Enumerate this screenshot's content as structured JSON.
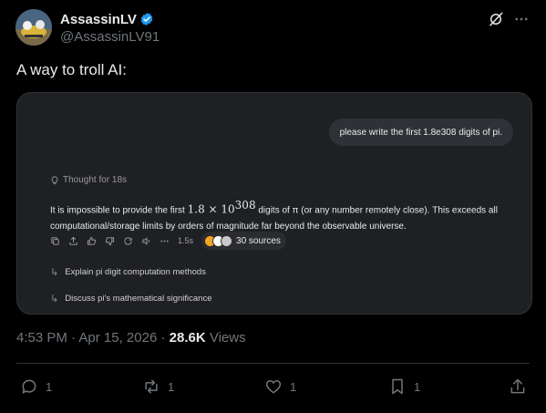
{
  "author": {
    "display_name": "AssassinLV",
    "handle": "@AssassinLV91",
    "verified": true
  },
  "tweet": {
    "text": "A way to troll AI:"
  },
  "screenshot": {
    "prompt": "please write the first 1.8e308 digits of pi.",
    "thought_label": "Thought for 18s",
    "answer_before": "It is impossible to provide the first ",
    "answer_math": "1.8 × 10",
    "answer_exponent": "308",
    "answer_after": " digits of π (or any number remotely close). This exceeds all computational/storage limits by orders of magnitude far beyond the observable universe.",
    "response_time": "1.5s",
    "sources_label": "30 sources",
    "followups": [
      "Explain pi digit computation methods",
      "Discuss pi's mathematical significance"
    ]
  },
  "meta": {
    "time": "4:53 PM",
    "separator": "·",
    "date": "Apr 15, 2026",
    "views_count": "28.6K",
    "views_label": "Views"
  },
  "engagement": {
    "replies": "1",
    "reposts": "1",
    "likes": "1",
    "bookmarks": "1"
  },
  "colors": {
    "background": "#000000",
    "text": "#e7e9ea",
    "muted": "#71767b",
    "verified_blue": "#1d9bf0",
    "card_bg": "#1f2023"
  }
}
